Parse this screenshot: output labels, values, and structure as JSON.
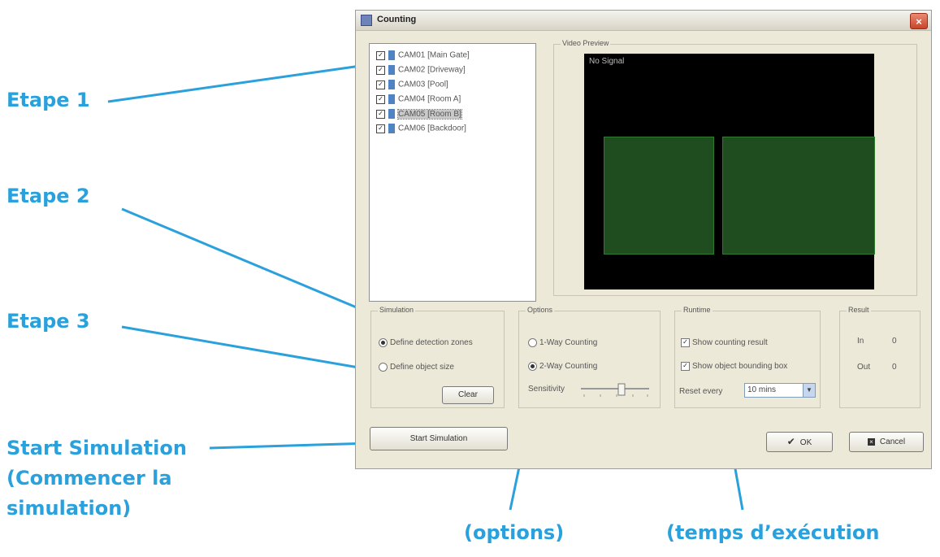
{
  "callouts": {
    "etape1": "Etape 1",
    "etape2": "Etape 2",
    "etape3": "Etape 3",
    "start_line1": "Start Simulation",
    "start_line2": "(Commencer la",
    "start_line3": "simulation)",
    "options": "(options)",
    "temps": "(temps d’exécution"
  },
  "accent_color": "#2aa1dc",
  "dialog": {
    "title": "Counting",
    "close_icon": "×",
    "cameras": [
      {
        "label": "CAM01 [Main Gate]",
        "checked": true
      },
      {
        "label": "CAM02 [Driveway]",
        "checked": true
      },
      {
        "label": "CAM03 [Pool]",
        "checked": true
      },
      {
        "label": "CAM04 [Room A]",
        "checked": true
      },
      {
        "label": "CAM05 [Room B]",
        "checked": true,
        "selected": true
      },
      {
        "label": "CAM06 [Backdoor]",
        "checked": true
      }
    ],
    "video_preview": {
      "label": "Video Preview",
      "overlay_text": "No Signal"
    },
    "simulation": {
      "label": "Simulation",
      "define_detection": "Define detection zones",
      "define_object": "Define object size",
      "clear": "Clear"
    },
    "options": {
      "label": "Options",
      "one_way": "1-Way Counting",
      "two_way": "2-Way Counting",
      "sensitivity": "Sensitivity"
    },
    "runtime": {
      "label": "Runtime",
      "show_result": "Show counting result",
      "show_bounding": "Show object bounding box",
      "reset_every_label": "Reset every",
      "reset_every_value": "10 mins"
    },
    "result": {
      "label": "Result",
      "in_label": "In",
      "in_value": "0",
      "out_label": "Out",
      "out_value": "0"
    },
    "start_simulation": "Start Simulation",
    "ok": "OK",
    "cancel": "Cancel"
  }
}
